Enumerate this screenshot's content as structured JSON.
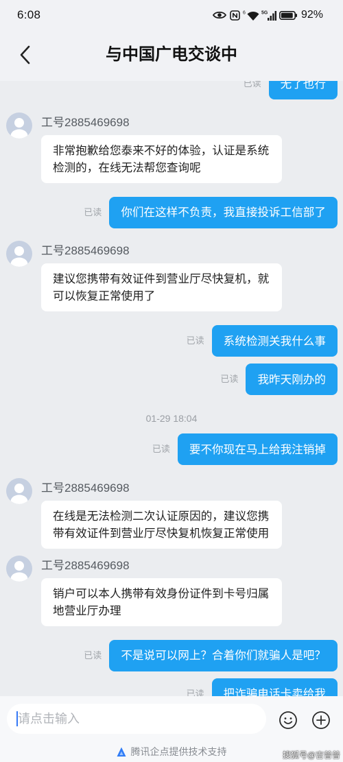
{
  "status_bar": {
    "time": "6:08",
    "wifi_badge": "6",
    "network_type": "5G",
    "battery_text": "92%",
    "battery_level": 0.92,
    "icons": [
      "eye-icon",
      "nfc-icon",
      "wifi-icon",
      "signal-icon",
      "battery-icon"
    ]
  },
  "header": {
    "back_icon": "chevron-left-icon",
    "title": "与中国广电交谈中"
  },
  "chat": {
    "messages": [
      {
        "outgoing": true,
        "text": "无了也行",
        "read_status": "已读"
      },
      {
        "outgoing": false,
        "agent_name": "工号2885469698",
        "avatar_icon": "default-avatar-icon",
        "text": "非常抱歉给您泰来不好的体验，认证是系统检测的，在线无法帮您查询呢"
      },
      {
        "outgoing": true,
        "text": "你们在这样不负责，我直接投诉工信部了",
        "read_status": "已读"
      },
      {
        "outgoing": false,
        "agent_name": "工号2885469698",
        "avatar_icon": "default-avatar-icon",
        "text": "建议您携带有效证件到营业厅尽快复机，就可以恢复正常使用了"
      },
      {
        "outgoing": true,
        "text": "系统检测关我什么事",
        "read_status": "已读"
      },
      {
        "outgoing": true,
        "text": "我昨天刚办的",
        "read_status": "已读"
      },
      {
        "timestamp": "01-29 18:04"
      },
      {
        "outgoing": true,
        "text": "要不你现在马上给我注销掉",
        "read_status": "已读"
      },
      {
        "outgoing": false,
        "agent_name": "工号2885469698",
        "avatar_icon": "default-avatar-icon",
        "text": "在线是无法检测二次认证原因的，建议您携带有效证件到营业厅尽快复机恢复正常使用"
      },
      {
        "outgoing": false,
        "agent_name": "工号2885469698",
        "avatar_icon": "default-avatar-icon",
        "text": "销户可以本人携带有效身份证件到卡号归属地营业厅办理"
      },
      {
        "outgoing": true,
        "text": "不是说可以网上？合着你们就骗人是吧？",
        "read_status": "已读"
      },
      {
        "outgoing": true,
        "text": "把诈骗电话卡卖给我",
        "read_status": "已读"
      }
    ]
  },
  "input_bar": {
    "placeholder": "请点击输入",
    "emoji_icon": "smiley-icon",
    "add_icon": "plus-circle-icon"
  },
  "footer": {
    "logo_icon": "qidian-logo-icon",
    "powered_by": "腾讯企点提供技术支持"
  },
  "watermark": "搜狐号@吉普普",
  "colors": {
    "accent": "#1fa1f2",
    "chat_background": "#ebedf0",
    "agent_bubble": "#ffffff",
    "user_bubble_text": "#ffffff",
    "read_status": "#a2a6ab"
  }
}
